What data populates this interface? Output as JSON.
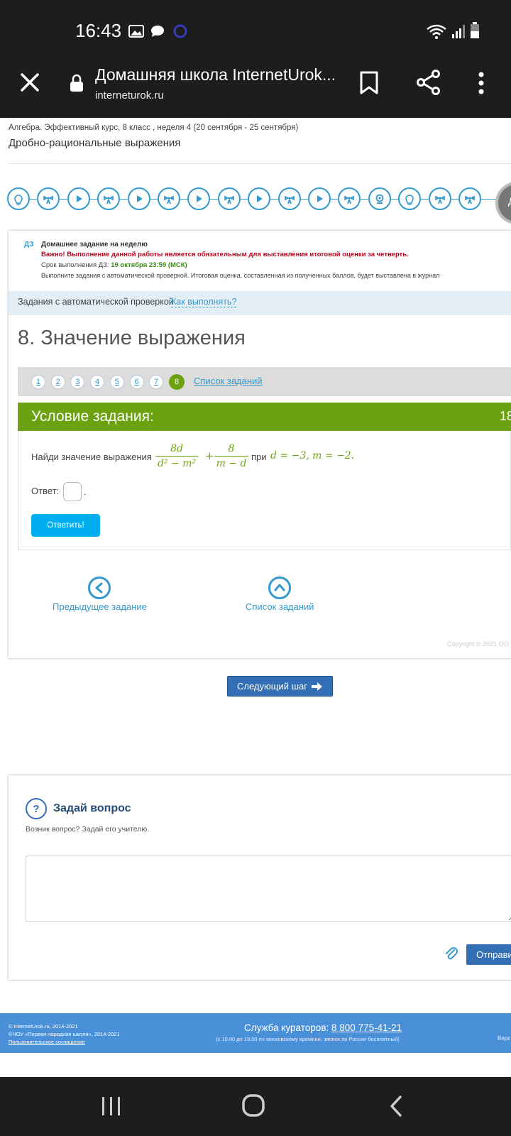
{
  "status_bar": {
    "time": "16:43",
    "icons": [
      "image-icon",
      "chat-icon",
      "sync-icon",
      "wifi-icon",
      "signal-icon",
      "battery-icon"
    ]
  },
  "browser": {
    "title": "Домашняя школа InternetUrok...",
    "url": "interneturok.ru",
    "icons": [
      "close-icon",
      "lock-icon",
      "bookmark-icon",
      "share-icon",
      "more-icon"
    ]
  },
  "breadcrumb": "Алгебра. Эффективный курс, 8 класс , неделя 4 (20 сентября - 25 сентября)",
  "lesson_title": "Дробно-рациональные выражения",
  "step_nav": {
    "icons": [
      "lightbulb-icon",
      "weights-icon",
      "play-icon",
      "weights-icon",
      "play-icon",
      "weights-icon",
      "play-icon",
      "weights-icon",
      "play-icon",
      "weights-icon",
      "play-icon",
      "weights-icon",
      "webcam-icon",
      "lightbulb-icon",
      "weights-icon",
      "weights-icon"
    ],
    "current_label": "Д"
  },
  "homework": {
    "badge": "ДЗ",
    "title": "Домашнее задание на неделю",
    "warning": "Важно! Выполнение данной работы является обязательным для выставления итоговой оценки за четверть.",
    "deadline_label": "Срок выполнения ДЗ:",
    "deadline_value": "19 октября 23:59 (МСК)",
    "note": "Выполните задания с автоматической проверкой. Итоговая оценка, составленная из полученных баллов, будет выставлена в журнал"
  },
  "tasks_bar": {
    "label": "Задания с автоматической проверкой",
    "link": "Как выполнять?"
  },
  "task_title": "8. Значение выражения",
  "pager": {
    "pages": [
      "1",
      "2",
      "3",
      "4",
      "5",
      "6",
      "7",
      "8"
    ],
    "active": "8",
    "list_link": "Список заданий"
  },
  "condition": {
    "header": "Условие задания:",
    "points": "18",
    "text_before": "Найди значение выражения",
    "frac1_num": "8d",
    "frac1_den": "d² − m²",
    "plus": "+",
    "frac2_num": "8",
    "frac2_den": "m − d",
    "text_mid": "при",
    "values": "d = −3, m = −2."
  },
  "answer": {
    "label": "Ответ:",
    "value": "",
    "dot": ".",
    "button": "Ответить!"
  },
  "task_nav": {
    "prev": "Предыдущее задание",
    "list": "Список заданий"
  },
  "copyright": "Copyright © 2021 ОО",
  "next_step": "Следующий шаг",
  "ask": {
    "icon_text": "?",
    "title": "Задай вопрос",
    "subtitle": "Возник вопрос? Задай его учителю.",
    "send": "Отправить"
  },
  "footer": {
    "line1": "© InternetUrok.ru, 2014-2021",
    "line2": "©ЧОУ «Первая народная школа», 2014-2021",
    "line3": "Пользовательское соглашение",
    "service_label": "Служба кураторов:",
    "phone": "8 800 775-41-21",
    "hours": "(с 10.00 до 19.00 по московскому времени, звонок по России бесплатный)",
    "right": "Верс"
  }
}
